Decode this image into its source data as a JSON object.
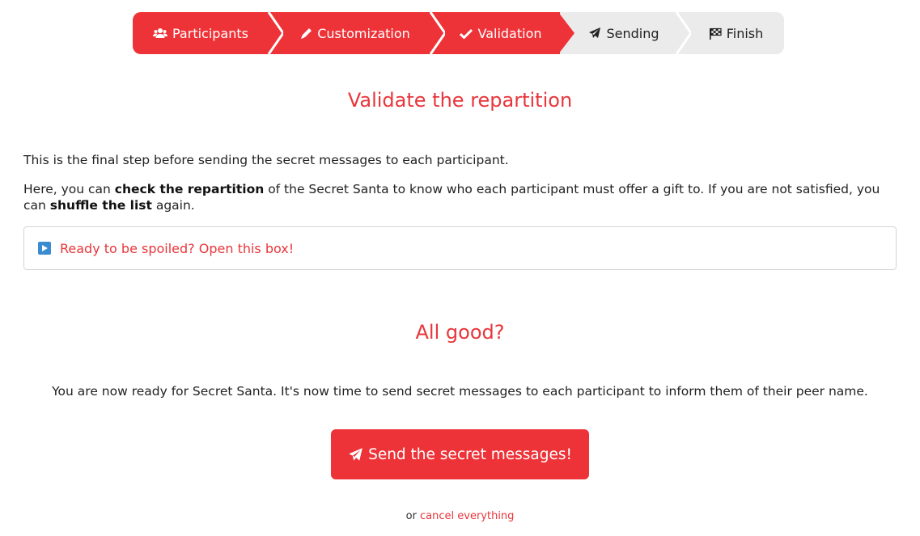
{
  "steps": [
    {
      "label": "Participants",
      "icon": "users-icon",
      "state": "done"
    },
    {
      "label": "Customization",
      "icon": "pencil-icon",
      "state": "done"
    },
    {
      "label": "Validation",
      "icon": "check-icon",
      "state": "done"
    },
    {
      "label": "Sending",
      "icon": "paper-plane-icon",
      "state": "todo"
    },
    {
      "label": "Finish",
      "icon": "checkered-flag-icon",
      "state": "todo"
    }
  ],
  "validate": {
    "title": "Validate the repartition",
    "intro": "This is the final step before sending the secret messages to each participant.",
    "desc_1": "Here, you can ",
    "desc_bold_1": "check the repartition",
    "desc_2": " of the Secret Santa to know who each participant must offer a gift to. If you are not satisfied, you can ",
    "desc_bold_2": "shuffle the list",
    "desc_3": " again."
  },
  "spoiler": {
    "label": "Ready to be spoiled? Open this box!",
    "icon": "play-icon"
  },
  "confirm": {
    "title": "All good?",
    "text": "You are now ready for Secret Santa. It's now time to send secret messages to each participant to inform them of their peer name.",
    "send_label": "Send the secret messages!",
    "or_label": "or",
    "cancel_label": "cancel everything"
  },
  "colors": {
    "accent": "#ee3338",
    "step_inactive": "#ebebeb",
    "play_icon": "#3a8bd0"
  }
}
